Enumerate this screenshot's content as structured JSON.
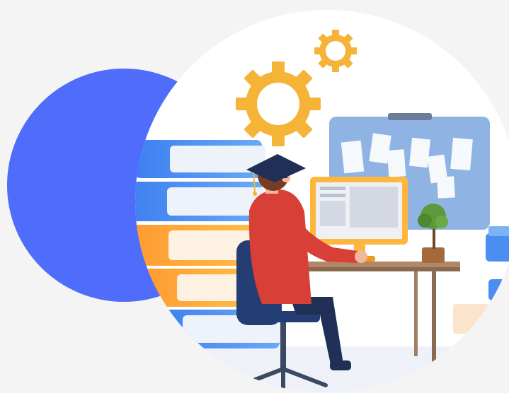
{
  "colors": {
    "background": "#f4f4f4",
    "accent_circle": "#4f6cfb",
    "main_circle": "#ffffff",
    "gear": "#f5b437",
    "board": "#8fb4e4",
    "monitor": "#fdb73e",
    "shirt": "#d83f36",
    "chair": "#243d73",
    "pants": "#1f2f55",
    "cap": "#1f2f55",
    "books_blue": "#4a8ff0",
    "books_orange": "#ffa93a",
    "desk": "#e6c5a3",
    "plant": "#5c9a3a"
  },
  "icons": [
    "large-gear-icon",
    "small-gear-icon",
    "graduation-cap-icon",
    "plant-icon"
  ]
}
